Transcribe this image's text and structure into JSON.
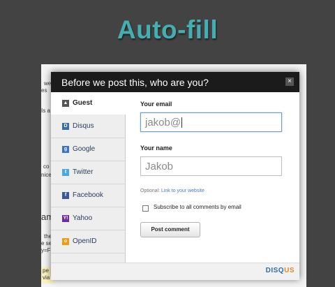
{
  "slide": {
    "title": "Auto-fill"
  },
  "background_page": {
    "fragments": [
      "we",
      "es",
      "Is a",
      "co",
      "nice",
      "am",
      "the",
      "e se",
      "y=F",
      "pe",
      "via"
    ]
  },
  "modal": {
    "header": "Before we post this, who are you?",
    "close_label": "×",
    "sidebar": {
      "items": [
        {
          "label": "Guest",
          "icon": "person-icon",
          "icon_glyph": "▲",
          "icon_color": "#555555",
          "active": true
        },
        {
          "label": "Disqus",
          "icon": "disqus-icon",
          "icon_glyph": "D",
          "icon_color": "#3b6ea5"
        },
        {
          "label": "Google",
          "icon": "google-icon",
          "icon_glyph": "g",
          "icon_color": "#3b73c9"
        },
        {
          "label": "Twitter",
          "icon": "twitter-icon",
          "icon_glyph": "t",
          "icon_color": "#4aa8e0"
        },
        {
          "label": "Facebook",
          "icon": "facebook-icon",
          "icon_glyph": "f",
          "icon_color": "#3b5998"
        },
        {
          "label": "Yahoo",
          "icon": "yahoo-icon",
          "icon_glyph": "Y!",
          "icon_color": "#6b2e9c"
        },
        {
          "label": "OpenID",
          "icon": "openid-icon",
          "icon_glyph": "o",
          "icon_color": "#f39c12"
        }
      ]
    },
    "form": {
      "email_label": "Your email",
      "email_value": "jakob@",
      "name_label": "Your name",
      "name_value": "Jakob",
      "optional_prefix": "Optional: ",
      "optional_link": "Link to your website",
      "subscribe_label": "Subscribe to all comments by email",
      "subscribe_checked": false,
      "post_button": "Post comment"
    },
    "footer": {
      "brand_main": "DISQ",
      "brand_accent": "US",
      "brand_color": "#2e6da4",
      "accent_color": "#e38a1d"
    }
  }
}
